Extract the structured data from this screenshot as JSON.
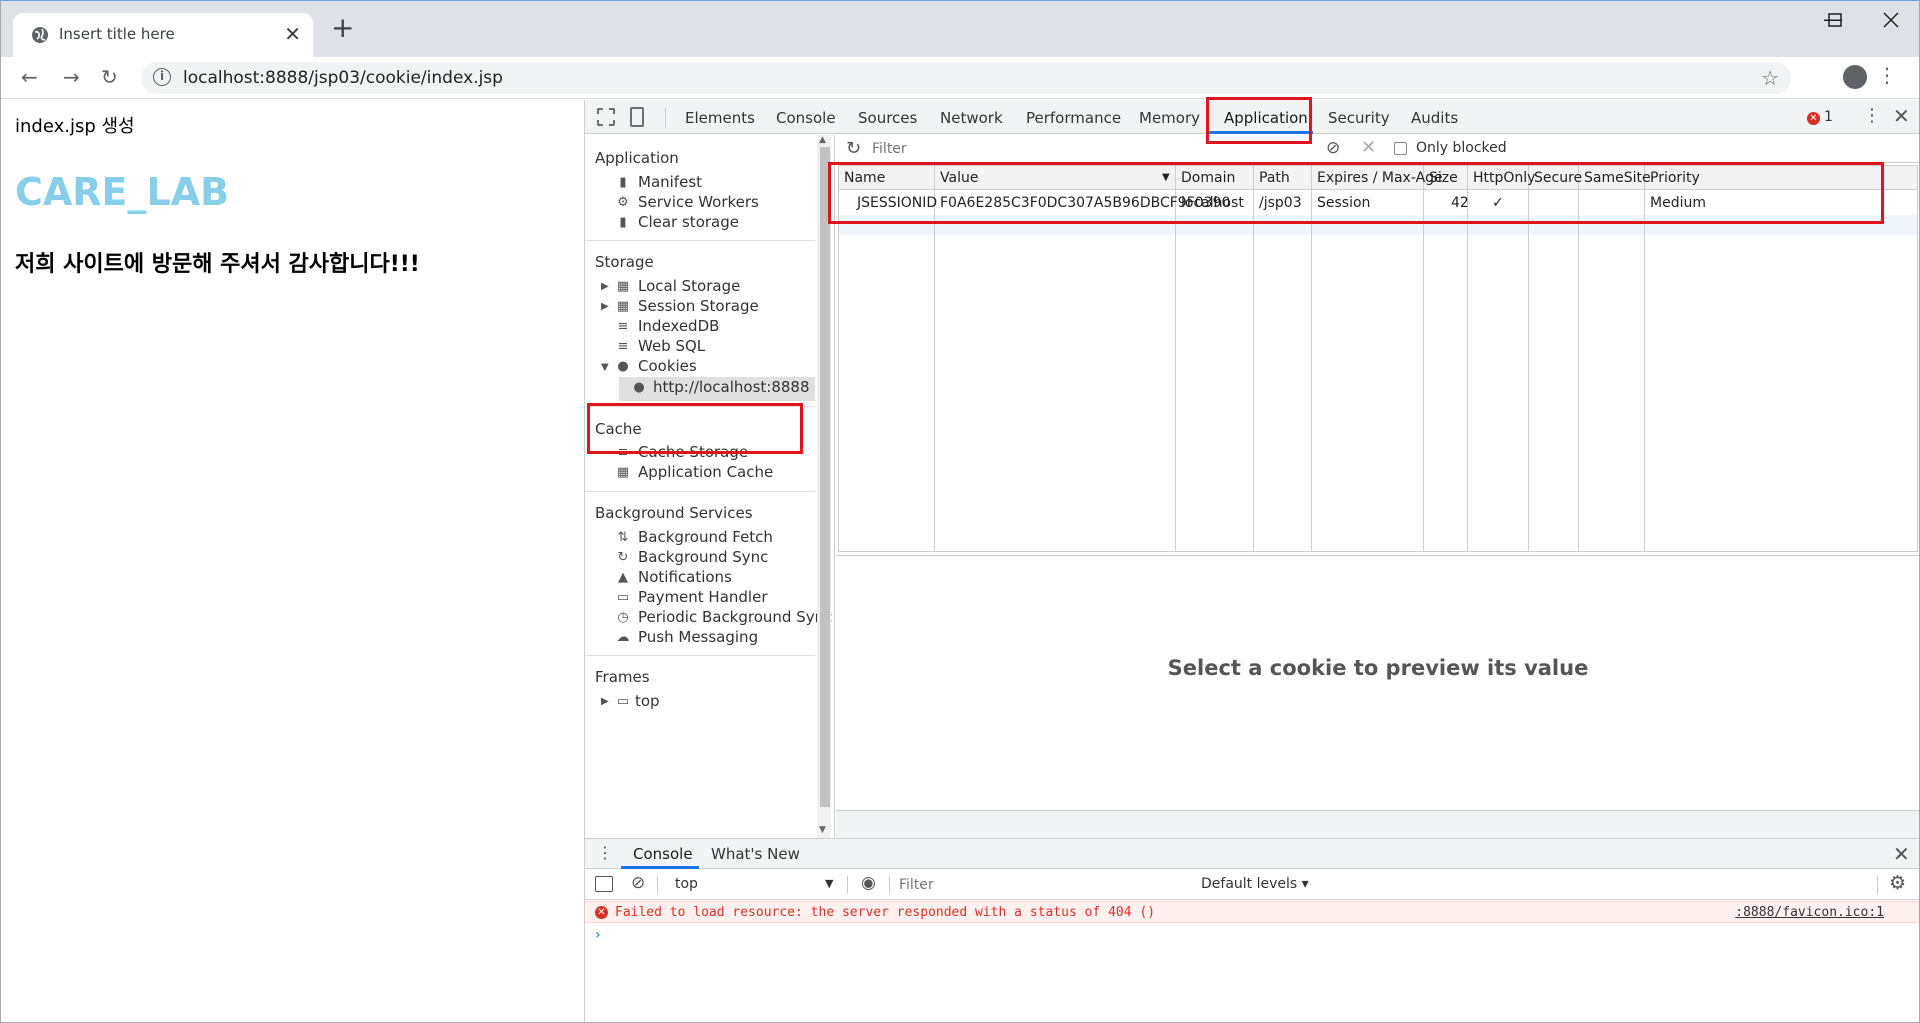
{
  "browser": {
    "tab_title": "Insert title here",
    "tab_close": "✕",
    "new_tab": "+",
    "url": "localhost:8888/jsp03/cookie/index.jsp",
    "icons": [
      "globe-icon",
      "back-icon",
      "forward-icon",
      "reload-icon",
      "info-icon",
      "star-icon",
      "profile-icon",
      "kebab-icon",
      "minimize-icon",
      "maximize-icon",
      "close-icon"
    ]
  },
  "page": {
    "line1": "index.jsp 생성",
    "brand": "CARE_LAB",
    "welcome": "저희 사이트에 방문해 주셔서 감사합니다!!!",
    "brand_color": "#87ceeb"
  },
  "devtools": {
    "tabs": [
      "Elements",
      "Console",
      "Sources",
      "Network",
      "Performance",
      "Memory",
      "Application",
      "Security",
      "Audits"
    ],
    "active_tab": "Application",
    "error_count": "1",
    "accent_color": "#1a73e8",
    "highlight_color": "#e0141e",
    "sidebar": {
      "application_header": "Application",
      "application_items": [
        "Manifest",
        "Service Workers",
        "Clear storage"
      ],
      "storage_header": "Storage",
      "storage_items": [
        "Local Storage",
        "Session Storage",
        "IndexedDB",
        "Web SQL",
        "Cookies",
        "http://localhost:8888"
      ],
      "cache_header": "Cache",
      "cache_items": [
        "Cache Storage",
        "Application Cache"
      ],
      "bg_header": "Background Services",
      "bg_items": [
        "Background Fetch",
        "Background Sync",
        "Notifications",
        "Payment Handler",
        "Periodic Background Sync",
        "Push Messaging"
      ],
      "frames_header": "Frames",
      "frames_items": [
        "top"
      ]
    },
    "cookies": {
      "filter_placeholder": "Filter",
      "only_blocked": "Only blocked",
      "columns": [
        "Name",
        "Value",
        "Domain",
        "Path",
        "Expires / Max-Age",
        "Size",
        "HttpOnly",
        "Secure",
        "SameSite",
        "Priority"
      ],
      "rows": [
        [
          "JSESSIONID",
          "F0A6E285C3F0DC307A5B96DBCF9F0390",
          "localhost",
          "/jsp03",
          "Session",
          "42",
          "✓",
          "",
          "",
          "Medium"
        ]
      ],
      "preview_message": "Select a cookie to preview its value"
    },
    "drawer": {
      "tabs": [
        "Console",
        "What's New"
      ],
      "context": "top",
      "filter_placeholder": "Filter",
      "levels": "Default levels ▾",
      "error_message": "Failed to load resource: the server responded with a status of 404 ()",
      "error_source": ":8888/favicon.ico:1",
      "prompt": "›"
    }
  }
}
